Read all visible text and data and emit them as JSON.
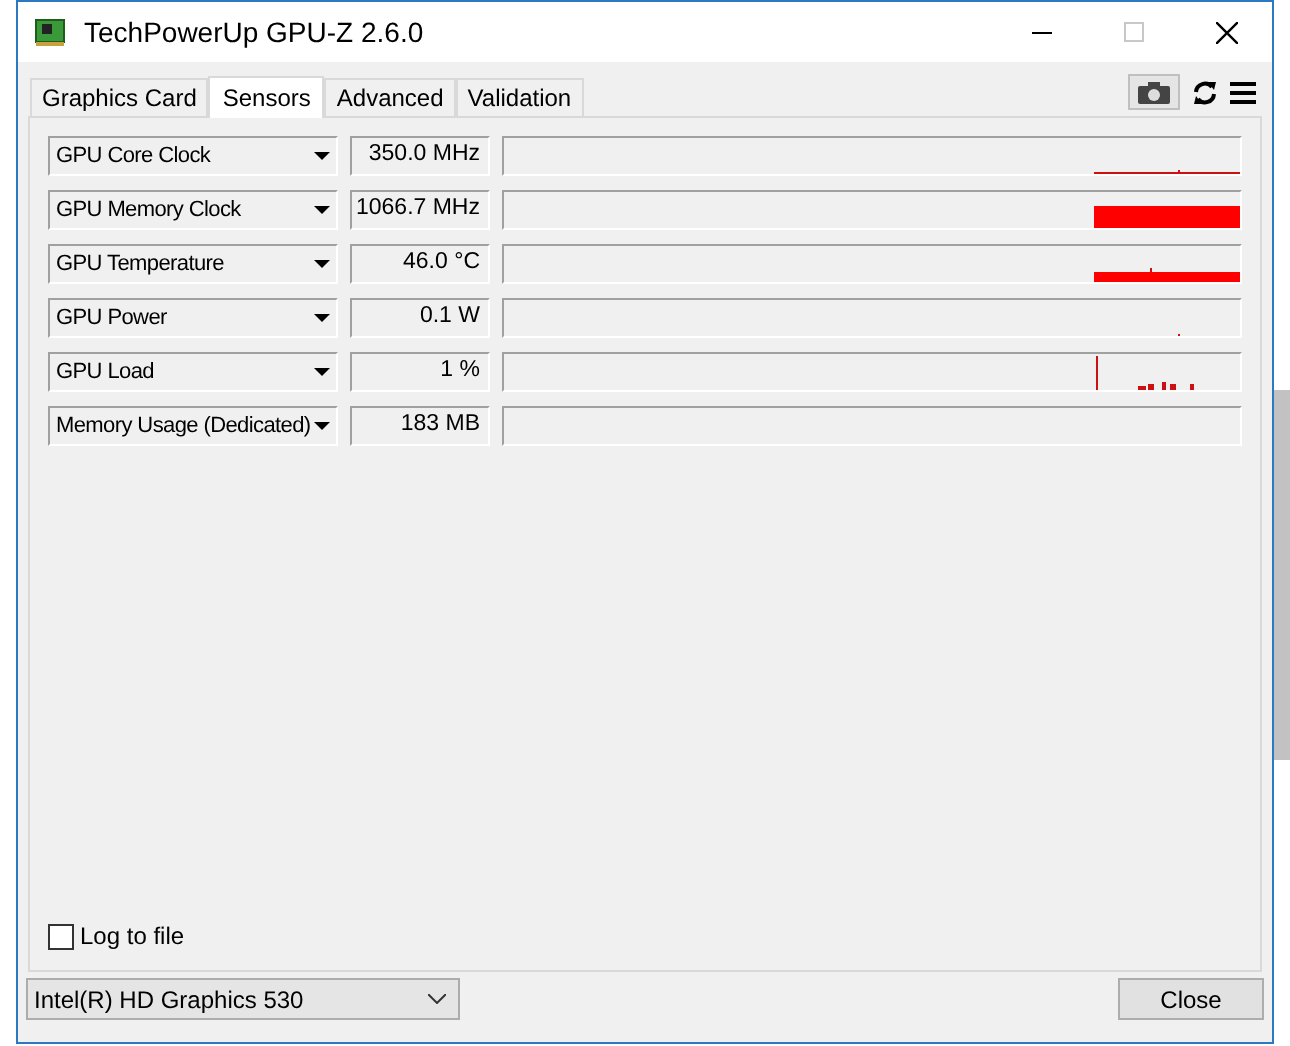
{
  "window": {
    "title": "TechPowerUp GPU-Z 2.6.0"
  },
  "tabs": [
    {
      "label": "Graphics Card",
      "selected": false
    },
    {
      "label": "Sensors",
      "selected": true
    },
    {
      "label": "Advanced",
      "selected": false
    },
    {
      "label": "Validation",
      "selected": false
    }
  ],
  "sensors": [
    {
      "name": "GPU Core Clock",
      "value": "350.0 MHz",
      "kind": "thin-line"
    },
    {
      "name": "GPU Memory Clock",
      "value": "1066.7 MHz",
      "kind": "tall-band"
    },
    {
      "name": "GPU Temperature",
      "value": "46.0 °C",
      "kind": "band"
    },
    {
      "name": "GPU Power",
      "value": "0.1 W",
      "kind": "dot"
    },
    {
      "name": "GPU Load",
      "value": "1 %",
      "kind": "spikes"
    },
    {
      "name": "Memory Usage (Dedicated)",
      "value": "183 MB",
      "kind": "empty"
    }
  ],
  "log_to_file": {
    "label": "Log to file",
    "checked": false
  },
  "gpu_select": {
    "value": "Intel(R) HD Graphics 530"
  },
  "close_button": {
    "label": "Close"
  }
}
